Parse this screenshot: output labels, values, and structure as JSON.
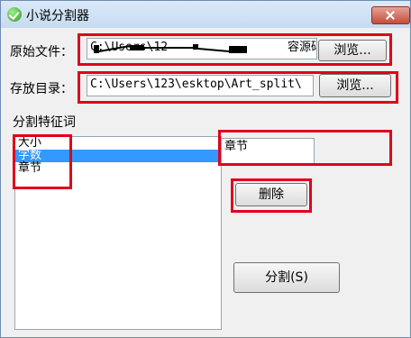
{
  "window": {
    "title": "小说分割器"
  },
  "source": {
    "label": "原始文件：",
    "path_start": "C:\\Users\\12",
    "path_end": "容源码Ž",
    "browse_label": "浏览..."
  },
  "output": {
    "label": "存放目录：",
    "path": "C:\\Users\\123\\esktop\\Art_split\\",
    "browse_label": "浏览..."
  },
  "split_feature": {
    "label": "分割特征词",
    "options": [
      "大小",
      "字数",
      "章节"
    ],
    "selected_index": 1,
    "current_value": "章节",
    "delete_label": "删除",
    "split_label": "分割(S)"
  },
  "colors": {
    "highlight_red": "#e0001b",
    "selection_blue": "#3399ff"
  }
}
